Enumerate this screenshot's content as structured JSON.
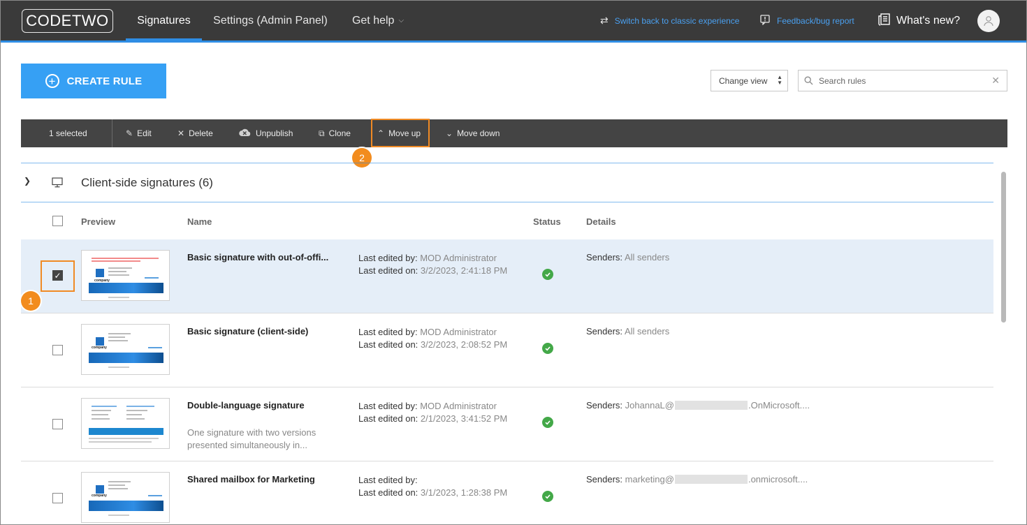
{
  "app": {
    "logo": "CODETWO",
    "tabs": [
      {
        "label": "Signatures"
      },
      {
        "label": "Settings (Admin Panel)"
      },
      {
        "label": "Get help"
      }
    ],
    "switch_link": "Switch back to classic experience",
    "feedback_link": "Feedback/bug report",
    "whats_new": "What's new?"
  },
  "actions": {
    "create_rule": "CREATE RULE",
    "change_view": "Change view",
    "search_placeholder": "Search rules"
  },
  "toolbar": {
    "selected": "1 selected",
    "edit": "Edit",
    "delete": "Delete",
    "unpublish": "Unpublish",
    "clone": "Clone",
    "move_up": "Move up",
    "move_down": "Move down"
  },
  "annotations": {
    "one": "1",
    "two": "2",
    "accent": "#f28c1e"
  },
  "group": {
    "title": "Client-side signatures (6)"
  },
  "columns": {
    "preview": "Preview",
    "name": "Name",
    "status": "Status",
    "details": "Details"
  },
  "labels": {
    "last_edited_by": "Last edited by:",
    "last_edited_on": "Last edited on:",
    "senders": "Senders:"
  },
  "rows": [
    {
      "name": "Basic signature with out-of-offi...",
      "description": "",
      "edited_by": "MOD Administrator",
      "edited_on": "3/2/2023, 2:41:18 PM",
      "senders_prefix": "All senders",
      "senders_suffix": "",
      "selected": true
    },
    {
      "name": "Basic signature (client-side)",
      "description": "",
      "edited_by": "MOD Administrator",
      "edited_on": "3/2/2023, 2:08:52 PM",
      "senders_prefix": "All senders",
      "senders_suffix": "",
      "selected": false
    },
    {
      "name": "Double-language signature",
      "description": "One signature with two versions presented simultaneously in...",
      "edited_by": "MOD Administrator",
      "edited_on": "2/1/2023, 3:41:52 PM",
      "senders_prefix": "JohannaL@",
      "senders_suffix": ".OnMicrosoft....",
      "selected": false
    },
    {
      "name": "Shared mailbox for Marketing",
      "description": "",
      "edited_by": "",
      "edited_on": "3/1/2023, 1:28:38 PM",
      "senders_prefix": "marketing@",
      "senders_suffix": ".onmicrosoft....",
      "selected": false
    }
  ],
  "colors": {
    "brand_blue": "#2f8de4",
    "status_green": "#43a848",
    "nav_bg": "#3a3a3a",
    "toolbar_bg": "#444444"
  }
}
